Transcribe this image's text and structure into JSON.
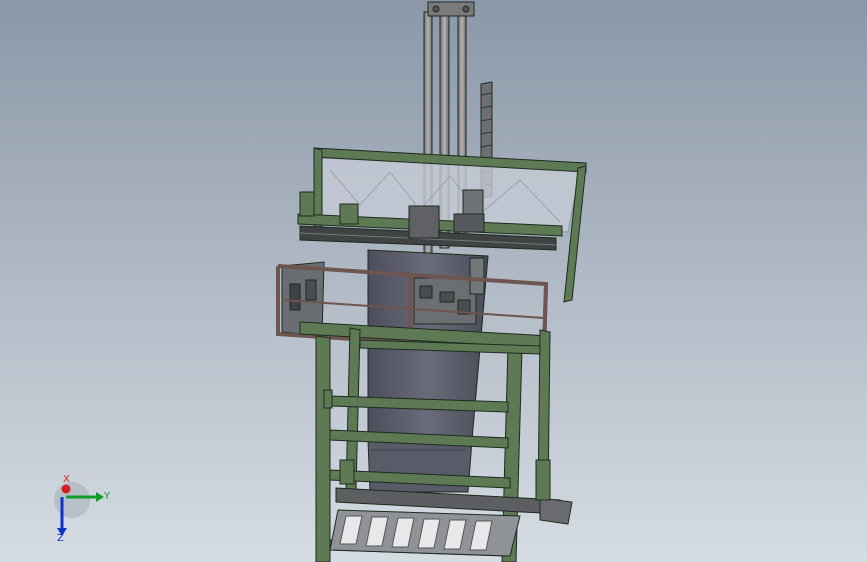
{
  "viewport": {
    "name": "cad-3d-viewport",
    "background_top": "#8b97a8",
    "background_bottom": "#d6dce3"
  },
  "model": {
    "name": "steel-frame-lifting-platform",
    "frame_color": "#5d7a55",
    "frame_edge_color": "#1f2a1f",
    "railing_color": "#8a6e68",
    "rod_color": "#8e8e8e",
    "body_color": "#5d5f6e",
    "glass_color": "#c6ccd6"
  },
  "triad": {
    "x_label": "X",
    "y_label": "Y",
    "z_label": "Z",
    "x_color": "#d11f1f",
    "y_color": "#0f9d2a",
    "z_color": "#1030c8"
  }
}
